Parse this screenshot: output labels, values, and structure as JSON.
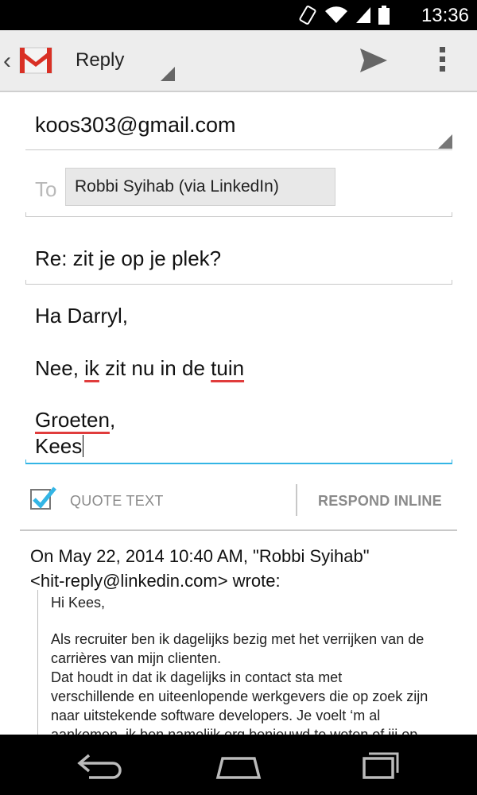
{
  "status_bar": {
    "time": "13:36",
    "icons": [
      "rotation-icon",
      "wifi-icon",
      "signal-icon",
      "battery-icon"
    ]
  },
  "action_bar": {
    "title": "Reply",
    "accent": "#d93025"
  },
  "compose": {
    "from": "koos303@gmail.com",
    "to_label": "To",
    "to_chip": "Robbi Syihab (via LinkedIn)",
    "subject": "Re: zit je op je plek?",
    "body": {
      "greeting": "Ha Darryl,",
      "line2_w1": "Nee, ",
      "line2_w2": "ik",
      "line2_w3": " zit nu in de ",
      "line2_w4": "tuin",
      "line3_w1": "Groeten",
      "line3_w2": ",",
      "line4": "Kees"
    }
  },
  "quote_controls": {
    "quote_text_label": "QUOTE TEXT",
    "quote_checked": true,
    "respond_inline_label": "RESPOND INLINE"
  },
  "quoted": {
    "header_line1": "On May 22, 2014 10:40 AM, \"Robbi Syihab\"",
    "header_line2": "<hit-reply@linkedin.com> wrote:",
    "lines": [
      "Hi Kees,",
      "Als recruiter ben ik dagelijks bezig met het verrijken van de",
      "carrières van mijn clienten.",
      "Dat houdt in dat ik dagelijks in contact sta met",
      "verschillende en uiteenlopende werkgevers die op zoek zijn",
      "naar uitstekende software developers. Je voelt ‘m al",
      "aankomen, ik ben namelijk erg benieuwd te weten of jij op"
    ]
  },
  "colors": {
    "accent_blue": "#33b5e5",
    "spell_red": "#e03c3c"
  },
  "nav_bar": {
    "buttons": [
      "back-icon",
      "home-icon",
      "recents-icon"
    ]
  }
}
